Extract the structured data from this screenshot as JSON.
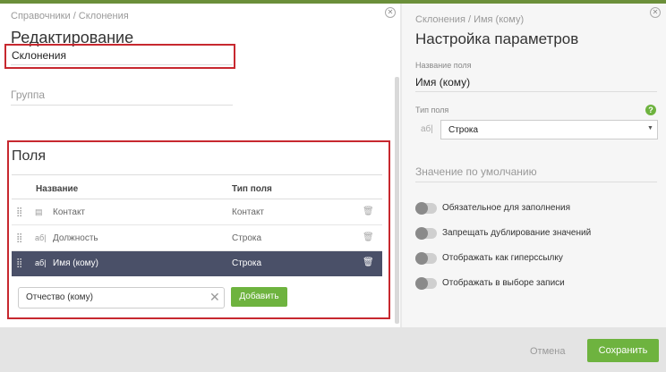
{
  "left": {
    "breadcrumb": "Справочники / Склонения",
    "title": "Редактирование",
    "name_value": "Склонения",
    "group_placeholder": "Группа",
    "fields": {
      "heading": "Поля",
      "col_name": "Название",
      "col_type": "Тип поля",
      "rows": [
        {
          "icon": "▤",
          "name": "Контакт",
          "type": "Контакт",
          "selected": false
        },
        {
          "icon": "аб|",
          "name": "Должность",
          "type": "Строка",
          "selected": false
        },
        {
          "icon": "аб|",
          "name": "Имя (кому)",
          "type": "Строка",
          "selected": true
        }
      ],
      "new_field_value": "Отчество (кому)",
      "add_label": "Добавить"
    }
  },
  "right": {
    "breadcrumb": "Склонения / Имя (кому)",
    "title": "Настройка параметров",
    "field_name_label": "Название поля",
    "field_name_value": "Имя (кому)",
    "type_label": "Тип поля",
    "type_icon": "аб|",
    "type_value": "Строка",
    "help_glyph": "?",
    "default_label": "Значение по умолчанию",
    "toggles": [
      "Обязательное для заполнения",
      "Запрещать дублирование значений",
      "Отображать как гиперссылку",
      "Отображать в выборе записи"
    ]
  },
  "footer": {
    "cancel_label": "Отмена",
    "save_label": "Сохранить"
  },
  "colors": {
    "accent_green": "#6eb33f",
    "selected_row": "#4a5068",
    "highlight_red": "#c7282f"
  }
}
